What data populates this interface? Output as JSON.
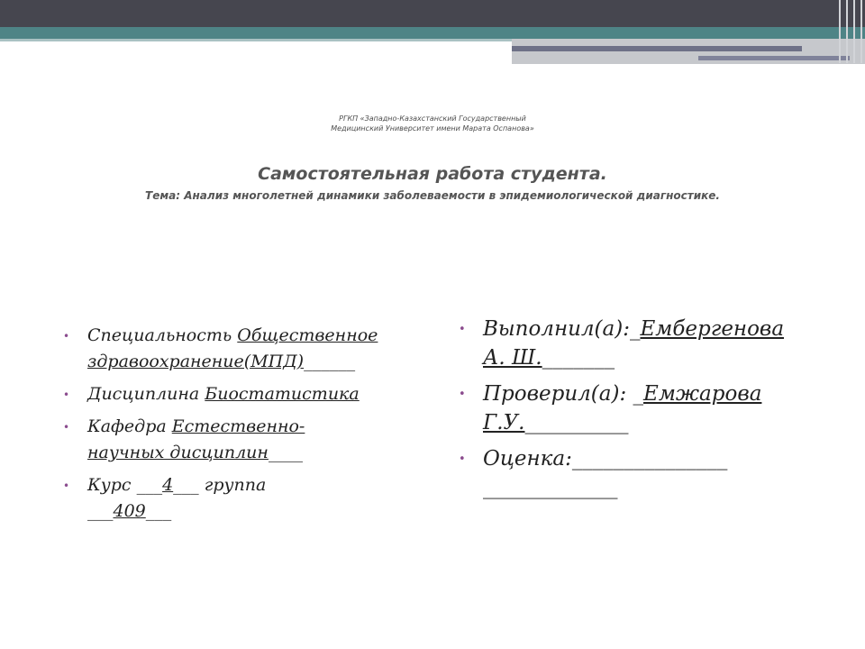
{
  "colors": {
    "header_dark": "#46464f",
    "header_teal": "#4e8486",
    "bullet": "#8b4c8e",
    "text": "#222222"
  },
  "header": {
    "org_line1": "РГКП «Западно-Казахстанский Государственный",
    "org_line2": "Медицинский Университет имени Марата Оспанова»",
    "title": "Самостоятельная работа студента.",
    "topic": "Тема: Анализ многолетней динамики заболеваемости в эпидемиологической диагностике."
  },
  "left_list": {
    "specialty": {
      "label": "Специальность ",
      "value_line1": "Общественное",
      "value_line2": "здравоохранение(МПД)",
      "blank": "______"
    },
    "discipline": {
      "label": "Дисциплина ",
      "value": "Биостатистика"
    },
    "department": {
      "label": "Кафедра ",
      "value_line1": "Естественно-",
      "value_line2": "научных дисциплин",
      "blank": "____"
    },
    "course": {
      "label": "Курс ",
      "pre": "___",
      "value": "4",
      "post": "___",
      "group_label": " группа",
      "group_pre": "___",
      "group_value": "409",
      "group_post": "___"
    }
  },
  "right_list": {
    "performed": {
      "label": "Выполнил(а):",
      "pre": "_",
      "value_line1": "Ембергенова",
      "value_line2": "А. Ш.",
      "blank": "_______"
    },
    "checked": {
      "label": "Проверил(а): ",
      "pre": "_",
      "value_line1": "Емжарова",
      "value_line2": "Г.У.",
      "blank1": "__",
      "blank2": "________"
    },
    "grade": {
      "label": "Оценка:",
      "blank1": "_______________",
      "blank2": "_____________"
    }
  }
}
